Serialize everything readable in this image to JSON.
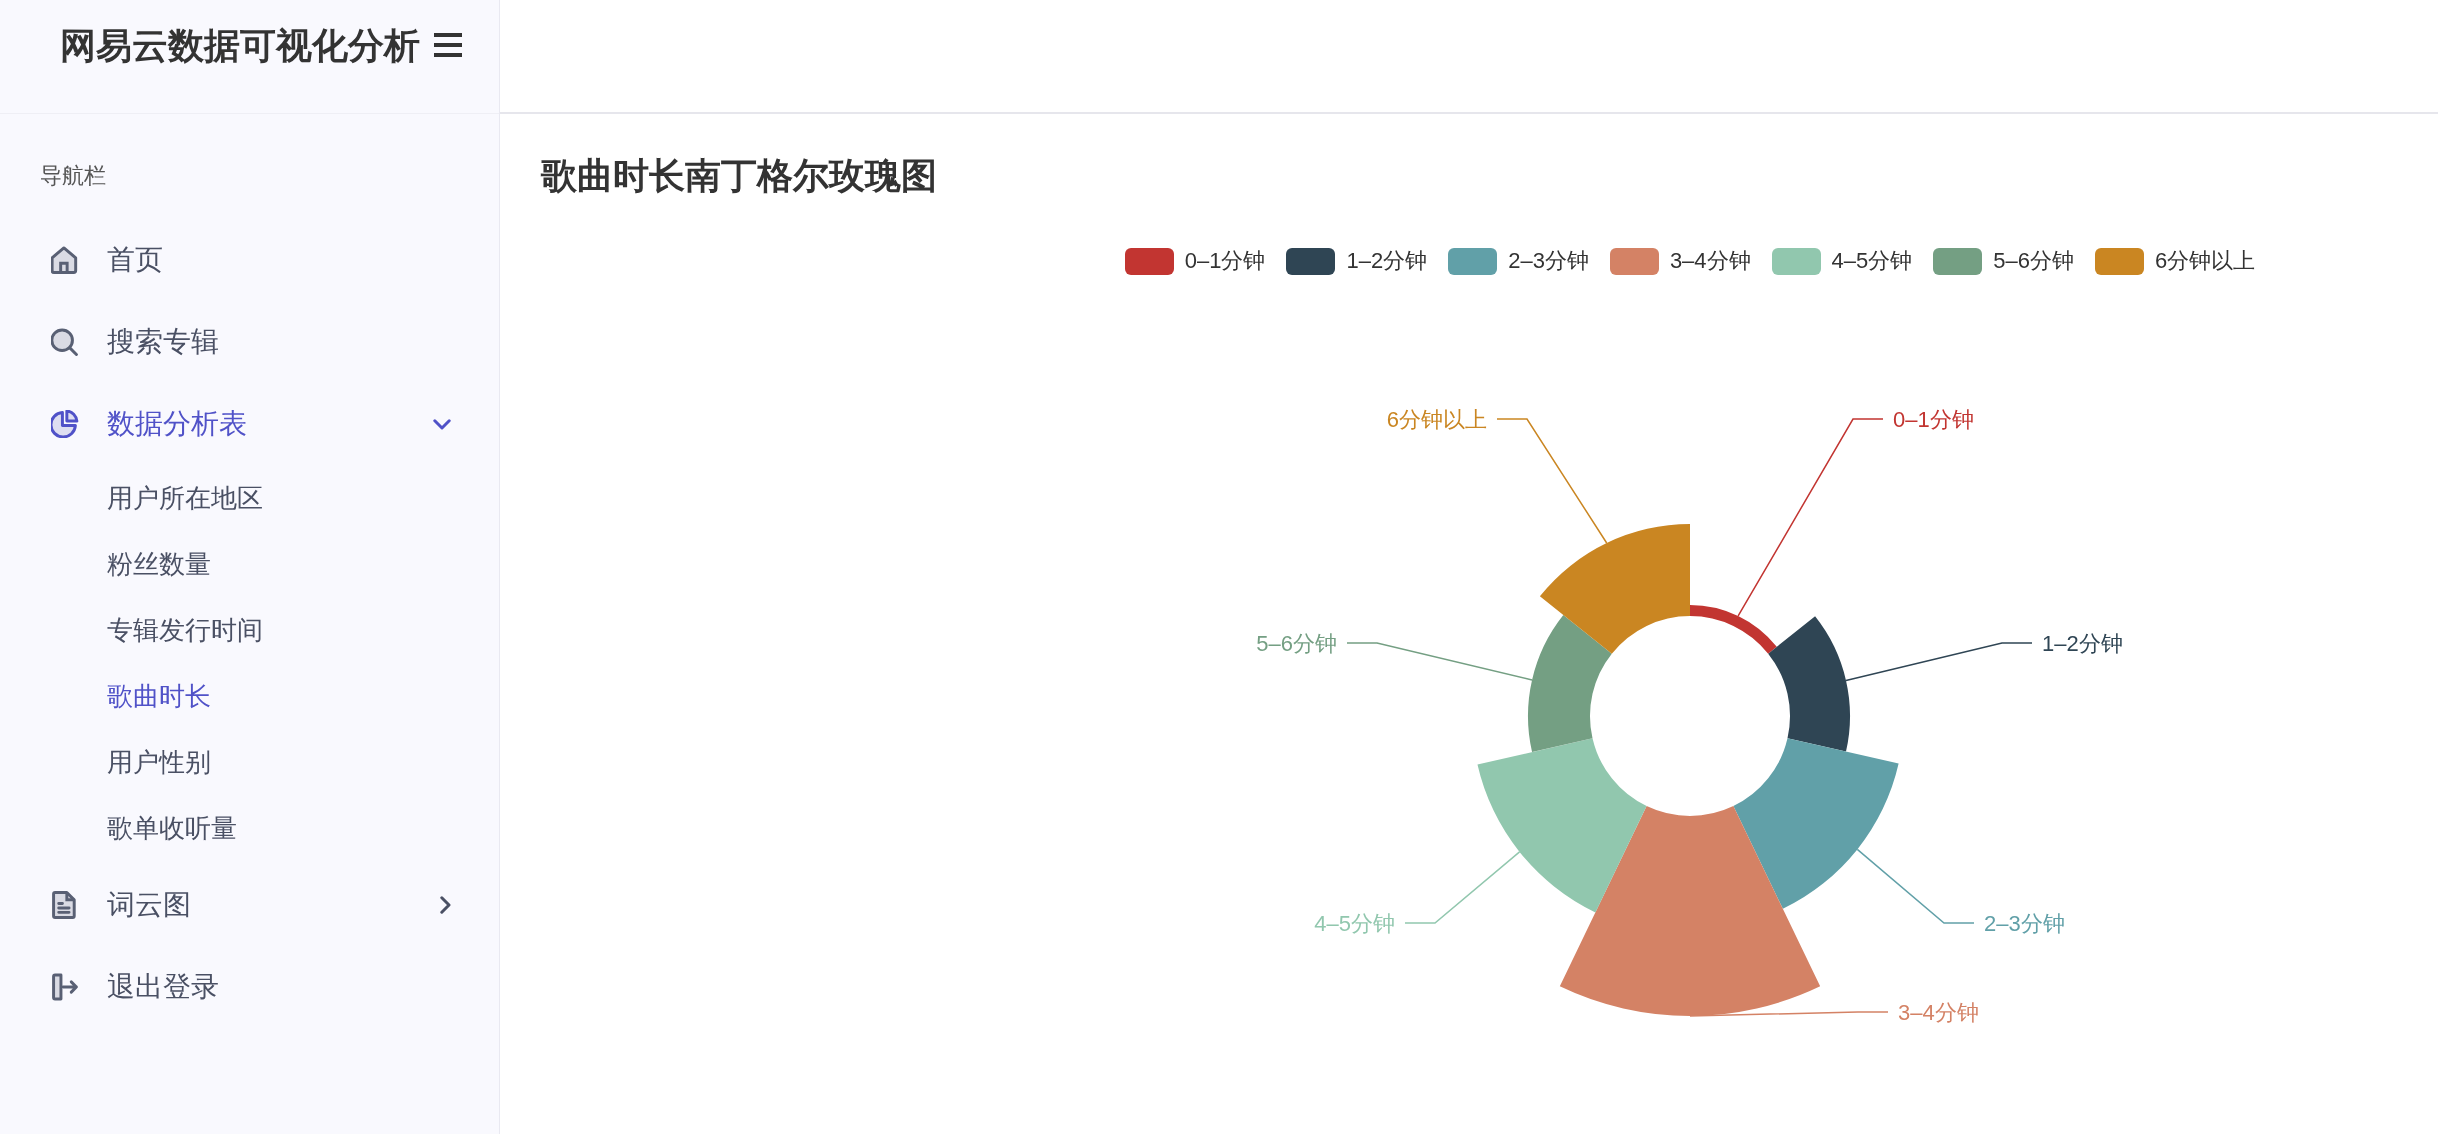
{
  "sidebar": {
    "title": "网易云数据可视化分析",
    "section_label": "导航栏",
    "items": [
      {
        "label": "首页",
        "kind": "link",
        "selected": false
      },
      {
        "label": "搜索专辑",
        "kind": "link",
        "selected": false
      },
      {
        "label": "数据分析表",
        "kind": "group",
        "selected": true,
        "expanded": true,
        "children": [
          {
            "label": "用户所在地区",
            "selected": false
          },
          {
            "label": "粉丝数量",
            "selected": false
          },
          {
            "label": "专辑发行时间",
            "selected": false
          },
          {
            "label": "歌曲时长",
            "selected": true
          },
          {
            "label": "用户性别",
            "selected": false
          },
          {
            "label": "歌单收听量",
            "selected": false
          }
        ]
      },
      {
        "label": "词云图",
        "kind": "group",
        "selected": false,
        "expanded": false
      },
      {
        "label": "退出登录",
        "kind": "link",
        "selected": false
      }
    ]
  },
  "page": {
    "title": "歌曲时长南丁格尔玫瑰图"
  },
  "chart": {
    "legend": [
      {
        "label": "0–1分钟",
        "color": "#c23531"
      },
      {
        "label": "1–2分钟",
        "color": "#2f4554"
      },
      {
        "label": "2–3分钟",
        "color": "#61a0a8"
      },
      {
        "label": "3–4分钟",
        "color": "#d48265"
      },
      {
        "label": "4–5分钟",
        "color": "#91c7ae"
      },
      {
        "label": "5–6分钟",
        "color": "#749f83"
      },
      {
        "label": "6分钟以上",
        "color": "#ca8622"
      }
    ],
    "slices": [
      {
        "label": "0–1分钟",
        "color": "#c23531"
      },
      {
        "label": "1–2分钟",
        "color": "#2f4554"
      },
      {
        "label": "2–3分钟",
        "color": "#61a0a8"
      },
      {
        "label": "3–4分钟",
        "color": "#d48265"
      },
      {
        "label": "4–5分钟",
        "color": "#91c7ae"
      },
      {
        "label": "5–6分钟",
        "color": "#749f83"
      },
      {
        "label": "6分钟以上",
        "color": "#ca8622"
      }
    ]
  }
}
